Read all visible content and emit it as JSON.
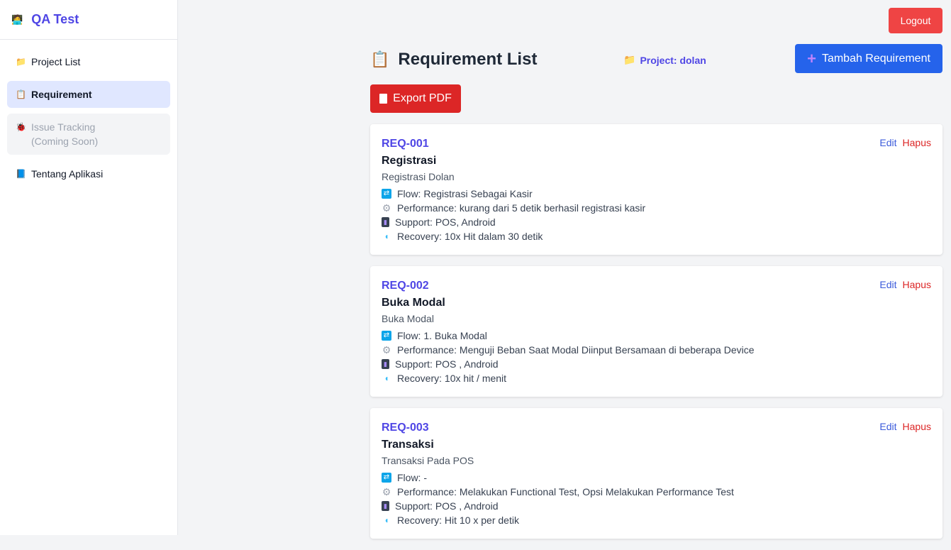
{
  "app": {
    "brand_icon": "🧑‍💻",
    "brand_name": "QA Test"
  },
  "sidebar": {
    "items": [
      {
        "label": "Project List",
        "icon": "📁"
      },
      {
        "label": "Requirement",
        "icon": "📋"
      },
      {
        "label": "Issue Tracking (Coming Soon)",
        "icon": "🐞"
      },
      {
        "label": "Tentang Aplikasi",
        "icon": "📘"
      }
    ]
  },
  "header": {
    "logout_label": "Logout",
    "title_icon": "📋",
    "title": "Requirement List",
    "project_icon": "📁",
    "project_label": "Project: dolan",
    "add_icon": "+",
    "add_label": "Tambah Requirement",
    "export_label": "Export PDF"
  },
  "actions": {
    "edit": "Edit",
    "delete": "Hapus"
  },
  "requirements": [
    {
      "code": "REQ-001",
      "title": "Registrasi",
      "description": "Registrasi Dolan",
      "flow": "Flow: Registrasi Sebagai Kasir",
      "performance": "Performance: kurang dari 5 detik berhasil registrasi kasir",
      "support": "Support: POS, Android",
      "recovery": "Recovery: 10x Hit dalam 30 detik"
    },
    {
      "code": "REQ-002",
      "title": "Buka Modal",
      "description": "Buka Modal",
      "flow": "Flow: 1. Buka Modal",
      "performance": "Performance: Menguji Beban Saat Modal Diinput Bersamaan di beberapa Device",
      "support": "Support: POS , Android",
      "recovery": "Recovery: 10x hit / menit"
    },
    {
      "code": "REQ-003",
      "title": "Transaksi",
      "description": "Transaksi Pada POS",
      "flow": "Flow: -",
      "performance": "Performance: Melakukan Functional Test, Opsi Melakukan Performance Test",
      "support": "Support: POS , Android",
      "recovery": "Recovery: Hit 10 x per detik"
    }
  ],
  "icons": {
    "flow": "flow-icon",
    "performance": "gear-icon",
    "support": "phone-icon",
    "recovery": "shield-icon"
  },
  "colors": {
    "brand": "#4f46e5",
    "logout": "#ef4444",
    "add": "#2563eb",
    "export": "#dc2626",
    "active_nav": "#e0e7ff"
  }
}
